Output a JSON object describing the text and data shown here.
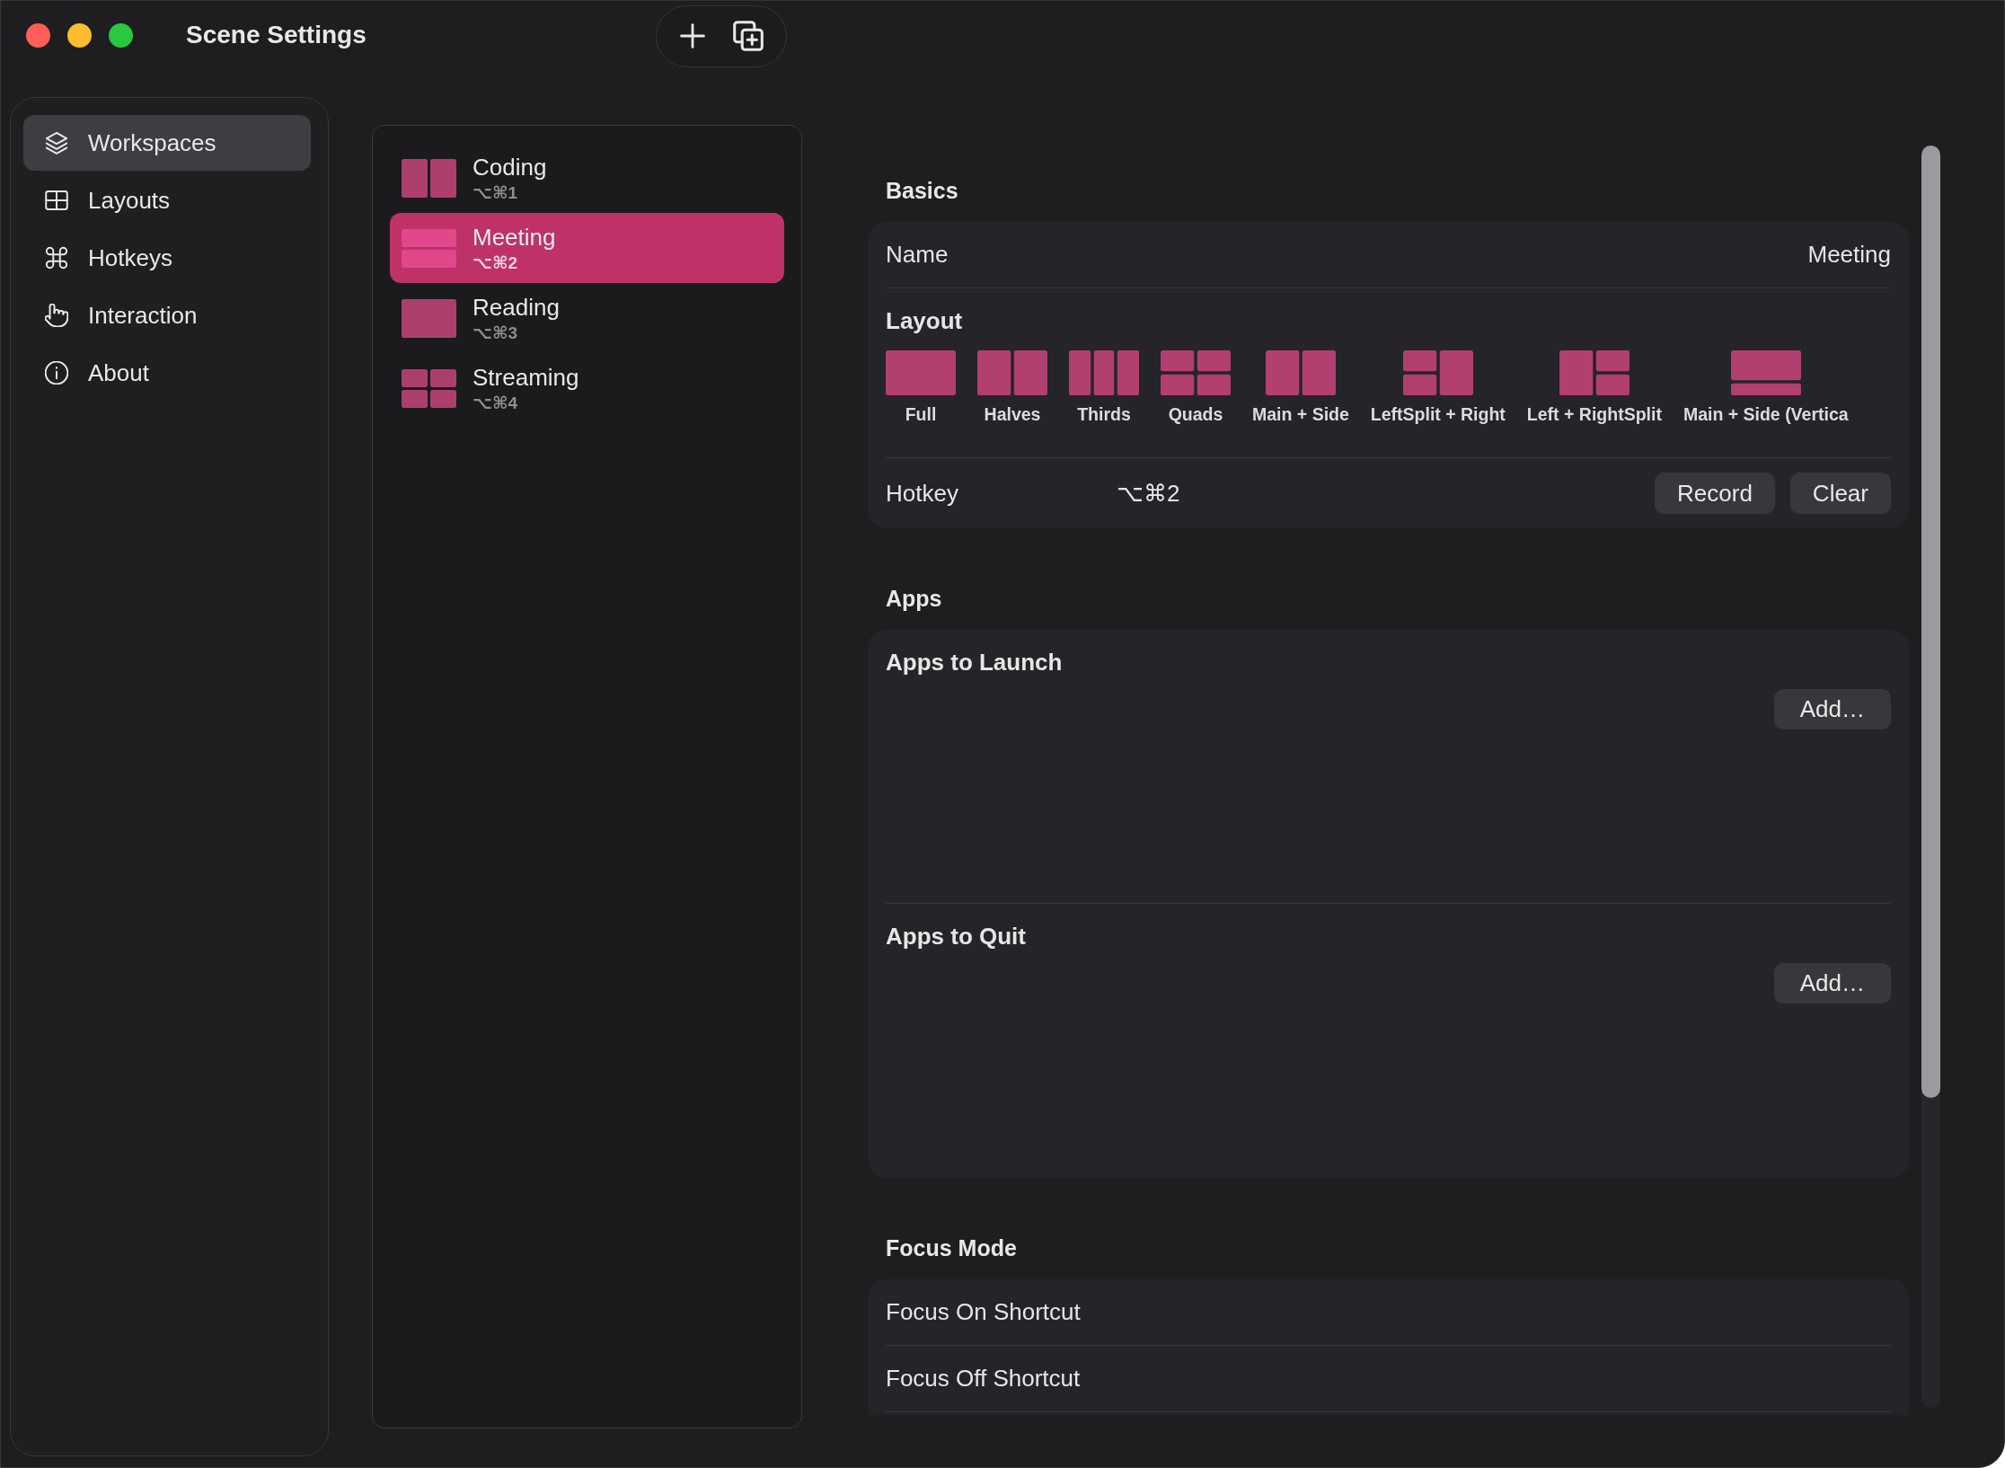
{
  "window": {
    "title": "Scene Settings"
  },
  "sidebar": {
    "items": [
      {
        "label": "Workspaces",
        "selected": true
      },
      {
        "label": "Layouts",
        "selected": false
      },
      {
        "label": "Hotkeys",
        "selected": false
      },
      {
        "label": "Interaction",
        "selected": false
      },
      {
        "label": "About",
        "selected": false
      }
    ]
  },
  "workspaces": [
    {
      "name": "Coding",
      "shortcut": "⌥⌘1",
      "kind": "halves",
      "selected": false
    },
    {
      "name": "Meeting",
      "shortcut": "⌥⌘2",
      "kind": "rows",
      "selected": true
    },
    {
      "name": "Reading",
      "shortcut": "⌥⌘3",
      "kind": "full",
      "selected": false
    },
    {
      "name": "Streaming",
      "shortcut": "⌥⌘4",
      "kind": "quads",
      "selected": false
    }
  ],
  "detail": {
    "basics": {
      "heading": "Basics",
      "name": {
        "label": "Name",
        "value": "Meeting"
      },
      "layout": {
        "label": "Layout",
        "options": [
          {
            "label": "Full",
            "kind": "full"
          },
          {
            "label": "Halves",
            "kind": "halves"
          },
          {
            "label": "Thirds",
            "kind": "thirds"
          },
          {
            "label": "Quads",
            "kind": "quads"
          },
          {
            "label": "Main + Side",
            "kind": "main-side"
          },
          {
            "label": "LeftSplit + Right",
            "kind": "leftsplit-right"
          },
          {
            "label": "Left + RightSplit",
            "kind": "left-rightsplit"
          },
          {
            "label": "Main + Side (Vertica",
            "kind": "main-side-vertical"
          }
        ]
      },
      "hotkey": {
        "label": "Hotkey",
        "value": "⌥⌘2",
        "buttons": [
          "Record",
          "Clear"
        ]
      }
    },
    "apps": {
      "heading": "Apps",
      "groups": [
        {
          "title": "Apps to Launch",
          "button": "Add…"
        },
        {
          "title": "Apps to Quit",
          "button": "Add…"
        }
      ]
    },
    "focus_mode": {
      "heading": "Focus Mode",
      "rows": [
        "Focus On Shortcut",
        "Focus Off Shortcut"
      ]
    }
  }
}
